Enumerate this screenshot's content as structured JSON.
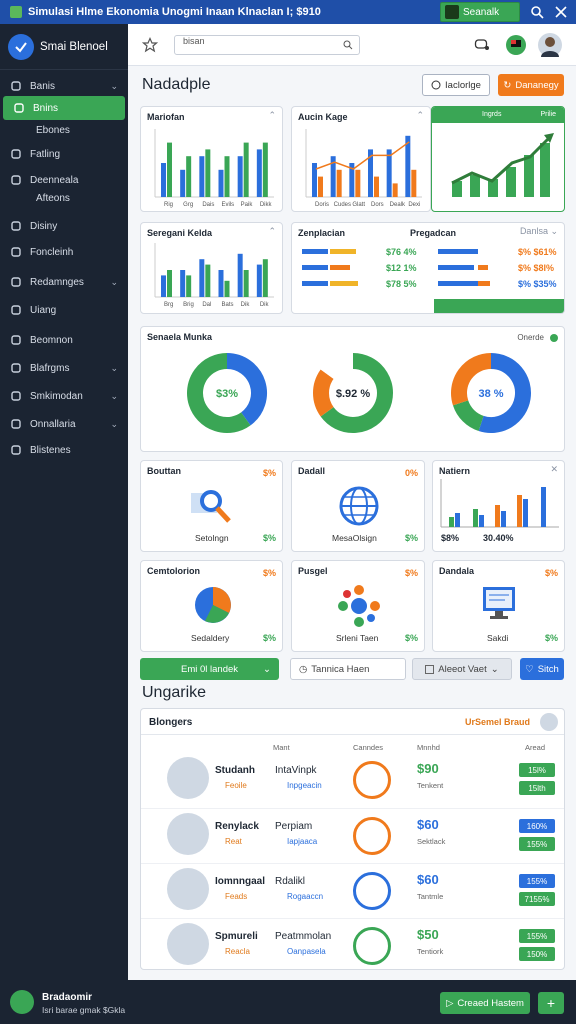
{
  "window": {
    "title": "Simulasi Hlme Ekonomia Unogmi Inaan Klnaclan I; $910",
    "search_button": "Seanalk"
  },
  "sidebar": {
    "brand": "Smai Blenoel",
    "items": [
      {
        "label": "Banis",
        "chev": true
      },
      {
        "label": "Bnins",
        "active": true
      },
      {
        "label": "Ebones",
        "sub": true
      },
      {
        "label": "Fatling"
      },
      {
        "label": "Deenneala"
      },
      {
        "label": "Afteons",
        "sub": true
      },
      {
        "label": "Disiny"
      },
      {
        "label": "Foncleinh"
      },
      {
        "label": "Redamnges",
        "chev": true
      },
      {
        "label": "Uiang"
      },
      {
        "label": "Beomnon"
      },
      {
        "label": "Blafrgms",
        "chev": true
      },
      {
        "label": "Smkimodan",
        "chev": true
      },
      {
        "label": "Onnallaria",
        "chev": true
      },
      {
        "label": "Blistenes"
      }
    ]
  },
  "header": {
    "search_placeholder": "bisan"
  },
  "dashboard": {
    "title": "Nadadple",
    "btn_outline": "Iaclorlge",
    "btn_orange": "Dananegy",
    "cards": {
      "c1": {
        "title": "Mariofan"
      },
      "c2": {
        "title": "Aucin Kage"
      },
      "c3": {
        "left": "Ingrds",
        "right": "Prilie"
      },
      "c4": {
        "title": "Seregani Kelda"
      },
      "c5": {
        "title": "Zenplacian",
        "mid": "Pregadcan",
        "right": "Danlsa",
        "vals": [
          "$76 4%",
          "$12 1%",
          "$78 5%"
        ],
        "rvals": [
          "$% $61%",
          "$% $8l%",
          "$% $35%"
        ]
      },
      "donut": {
        "title": "Senaela Munka",
        "legend": "Onerde",
        "labels": [
          "$3%",
          "$.92 %",
          "38 %"
        ]
      },
      "r1": [
        {
          "title": "Bouttan",
          "pct": "$%",
          "label": "Setolngn",
          "gpct": "$%"
        },
        {
          "title": "Dadall",
          "pct": "0%",
          "label": "MesaOlsign",
          "gpct": "$%"
        },
        {
          "title": "Natiern",
          "l1": "$8%",
          "l2": "30.40%"
        }
      ],
      "r2": [
        {
          "title": "Cemtolorion",
          "pct": "$%",
          "label": "Sedaldery",
          "gpct": "$%"
        },
        {
          "title": "Pusgel",
          "pct": "$%",
          "label": "Srleni Taen",
          "gpct": "$%"
        },
        {
          "title": "Dandala",
          "pct": "$%",
          "label": "Sakdi",
          "gpct": "$%"
        }
      ]
    },
    "bottom_bar": {
      "green": "Emi 0l landek",
      "input": "Tannica Haen",
      "select": "Aleeot Vaet",
      "blue": "Sitch"
    }
  },
  "list": {
    "title": "Ungarike",
    "header_left": "Blongers",
    "header_right": "UrSemel Braud",
    "cols": [
      "Mant",
      "Canndes",
      "Mnnhd",
      "Aread"
    ],
    "rows": [
      {
        "name": "Studanh",
        "sub": "Feoile",
        "prod": "IntaVinpk",
        "prod_sub": "Inpgeacin",
        "price": "$90",
        "price_sub": "Tenkent",
        "tags": [
          "15l%",
          "15lth"
        ],
        "blue": false
      },
      {
        "name": "Renylack",
        "sub": "Reat",
        "prod": "Perpiam",
        "prod_sub": "Iapjaaca",
        "price": "$60",
        "price_sub": "Sektlack",
        "tags": [
          "160%",
          "155%"
        ],
        "blue": true
      },
      {
        "name": "Iomnngaal",
        "sub": "Feads",
        "prod": "Rdalikl",
        "prod_sub": "Rogaaccn",
        "price": "$60",
        "price_sub": "Tantmle",
        "tags": [
          "155%",
          "7155%"
        ],
        "blue": true
      },
      {
        "name": "Spmureli",
        "sub": "Reacla",
        "prod": "Peatmmolan",
        "prod_sub": "Oanpasela",
        "price": "$50",
        "price_sub": "Tentiork",
        "tags": [
          "155%",
          "150%"
        ],
        "blue": false
      }
    ]
  },
  "footer": {
    "name": "Bradaomir",
    "sub": "Isri barae gmak $Gkla",
    "btn": "Creaed Hastem",
    "plus": "+"
  },
  "chart_data": [
    {
      "type": "bar",
      "title": "Mariofan",
      "categories": [
        "Rig",
        "Grg",
        "Dais",
        "Evils",
        "Paik",
        "Dikk"
      ],
      "series": [
        {
          "name": "A",
          "values": [
            5,
            4,
            6,
            4,
            6,
            7
          ]
        },
        {
          "name": "B",
          "values": [
            8,
            6,
            7,
            6,
            8,
            8
          ]
        }
      ]
    },
    {
      "type": "bar",
      "title": "Aucin Kage",
      "categories": [
        "Doris",
        "Cudes",
        "Glatt",
        "Dors",
        "Dealk",
        "Dexi"
      ],
      "series": [
        {
          "name": "A",
          "values": [
            5,
            6,
            5,
            7,
            7,
            9
          ]
        },
        {
          "name": "B",
          "values": [
            3,
            4,
            4,
            3,
            2,
            4
          ]
        }
      ]
    },
    {
      "type": "bar",
      "title": "Seregani Kelda",
      "categories": [
        "Brg",
        "Brig",
        "Dal",
        "Bats",
        "Dik",
        "Dik"
      ],
      "series": [
        {
          "name": "A",
          "values": [
            4,
            5,
            7,
            5,
            8,
            6
          ]
        },
        {
          "name": "B",
          "values": [
            5,
            4,
            6,
            3,
            5,
            7
          ]
        }
      ]
    },
    {
      "type": "pie",
      "title": "Senaela Munka",
      "values": [
        [
          40,
          60
        ],
        [
          65,
          20,
          15
        ],
        [
          55,
          15,
          30
        ]
      ]
    }
  ]
}
